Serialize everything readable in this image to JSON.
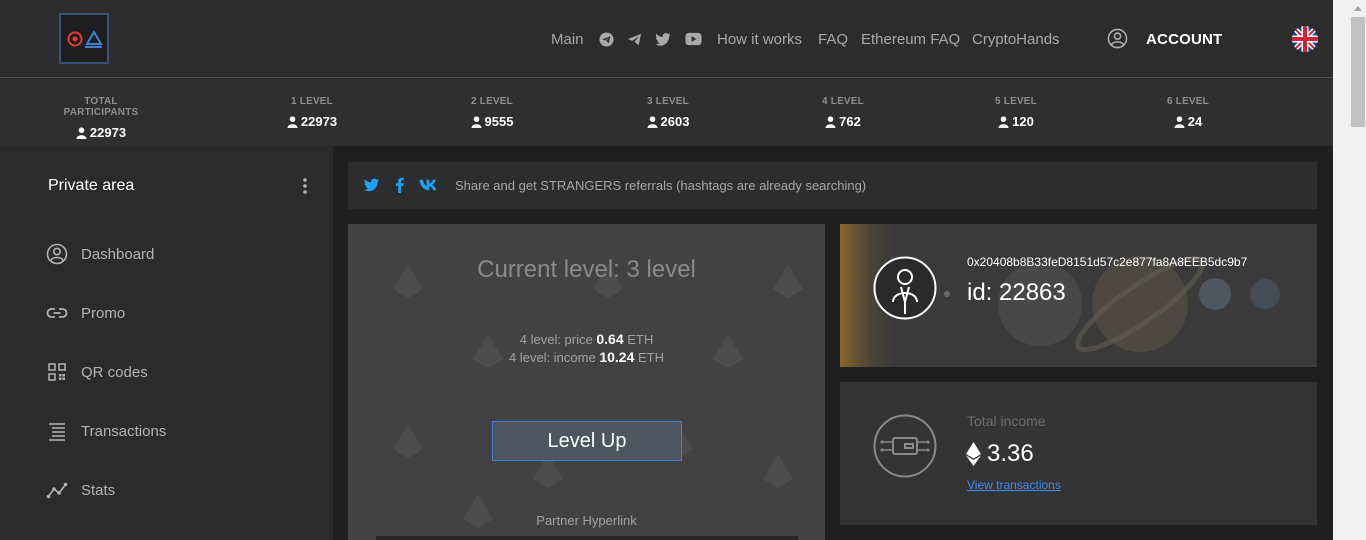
{
  "header": {
    "nav": [
      "Main",
      "How it works",
      "FAQ",
      "Ethereum FAQ",
      "CryptoHands"
    ],
    "social_icons": [
      "telegram-circle-icon",
      "telegram-icon",
      "twitter-icon",
      "youtube-icon"
    ],
    "account_label": "ACCOUNT",
    "flag_icon": "uk-flag-icon"
  },
  "stats": [
    {
      "label": "TOTAL PARTICIPANTS",
      "value": "22973"
    },
    {
      "label": "1 LEVEL",
      "value": "22973"
    },
    {
      "label": "2 LEVEL",
      "value": "9555"
    },
    {
      "label": "3 LEVEL",
      "value": "2603"
    },
    {
      "label": "4 LEVEL",
      "value": "762"
    },
    {
      "label": "5 LEVEL",
      "value": "120"
    },
    {
      "label": "6 LEVEL",
      "value": "24"
    }
  ],
  "sidebar": {
    "title": "Private area",
    "items": [
      {
        "label": "Dashboard",
        "icon": "user-circle-icon"
      },
      {
        "label": "Promo",
        "icon": "link-icon"
      },
      {
        "label": "QR codes",
        "icon": "qr-code-icon"
      },
      {
        "label": "Transactions",
        "icon": "list-icon"
      },
      {
        "label": "Stats",
        "icon": "stats-icon"
      }
    ]
  },
  "share": {
    "icons": [
      "twitter-icon",
      "facebook-icon",
      "vk-icon"
    ],
    "text": "Share and get STRANGERS referrals (hashtags are already searching)"
  },
  "level": {
    "title": "Current level: 3 level",
    "price_prefix": "4 level: price",
    "price": "0.64",
    "income_prefix": "4 level: income",
    "income": "10.24",
    "currency": "ETH",
    "button": "Level Up",
    "partner": "Partner Hyperlink"
  },
  "profile": {
    "address": "0x20408b8B33feD8151d57c2e877fa8A8EEB5dc9b7",
    "id": "id: 22863"
  },
  "income": {
    "label": "Total income",
    "value": "3.36",
    "link": "View transactions"
  },
  "colors": {
    "accent_blue": "#3c82d8",
    "link_blue": "#3d8bf0",
    "twitter_blue": "#1da1f2",
    "logo_red": "#e23a3a"
  }
}
